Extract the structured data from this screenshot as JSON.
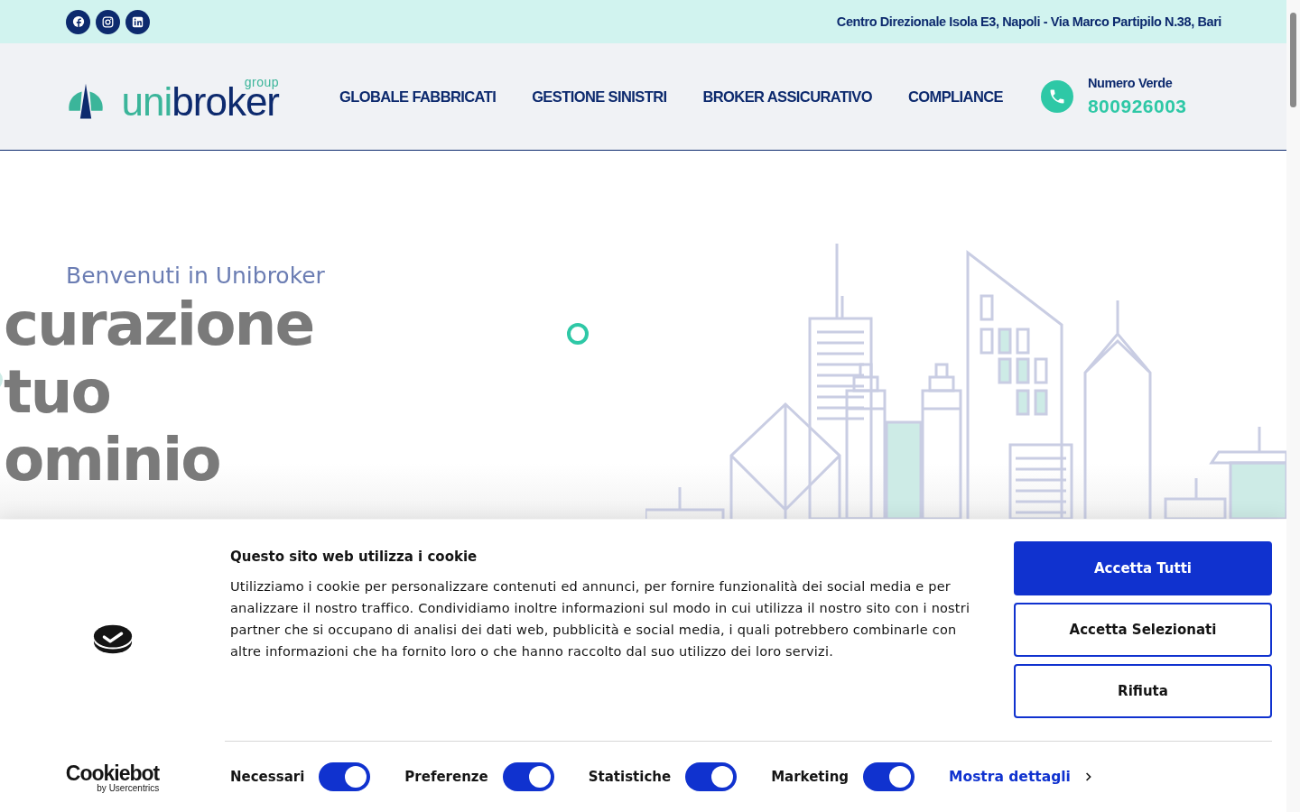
{
  "top_bar": {
    "social": [
      {
        "kind": "facebook"
      },
      {
        "kind": "instagram"
      },
      {
        "kind": "linkedin"
      }
    ],
    "address": "Centro Direzionale Isola E3, Napoli - Via Marco Partipilo N.38, Bari"
  },
  "header": {
    "logo": {
      "brand_a": "uni",
      "brand_b": "broker",
      "tag": "group"
    },
    "nav": [
      "GLOBALE FABBRICATI",
      "GESTIONE SINISTRI",
      "BROKER ASSICURATIVO",
      "COMPLIANCE"
    ],
    "phone": {
      "label": "Numero Verde",
      "number": "800926003"
    }
  },
  "hero": {
    "subtitle": "Benvenuti in Unibroker",
    "lines": [
      "curazione",
      "tuo",
      "ominio"
    ]
  },
  "cookie_banner": {
    "logo": {
      "name": "Cookiebot",
      "by": "by Usercentrics"
    },
    "title": "Questo sito web utilizza i cookie",
    "text": "Utilizziamo i cookie per personalizzare contenuti ed annunci, per fornire funzionalità dei social media e per analizzare il nostro traffico. Condividiamo inoltre informazioni sul modo in cui utilizza il nostro sito con i nostri partner che si occupano di analisi dei dati web, pubblicità e social media, i quali potrebbero combinarle con altre informazioni che ha fornito loro o che hanno raccolto dal suo utilizzo dei loro servizi.",
    "buttons": [
      {
        "label": "Accetta Tutti",
        "kind": "primary"
      },
      {
        "label": "Accetta Selezionati",
        "kind": "outline"
      },
      {
        "label": "Rifiuta",
        "kind": "outline"
      }
    ],
    "toggles": [
      {
        "label": "Necessari",
        "checked": true
      },
      {
        "label": "Preferenze",
        "checked": true
      },
      {
        "label": "Statistiche",
        "checked": true
      },
      {
        "label": "Marketing",
        "checked": true
      }
    ],
    "details_link": "Mostra dettagli"
  }
}
